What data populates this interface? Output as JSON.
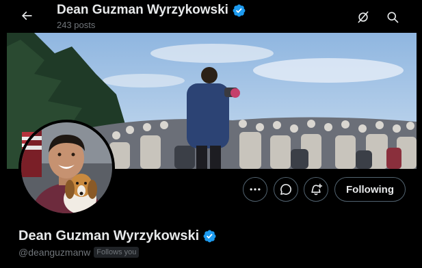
{
  "header": {
    "back_icon": "arrow-left-icon",
    "name": "Dean Guzman Wyrzykowski",
    "posts": "243 posts",
    "grok_icon": "grok-icon",
    "search_icon": "search-icon"
  },
  "profile": {
    "name": "Dean Guzman Wyrzykowski",
    "handle": "@deanguzmanw",
    "follows_you": "Follows you",
    "verified_icon": "verified-badge-icon"
  },
  "actions": {
    "more_icon": "more-horizontal-icon",
    "message_icon": "message-icon",
    "subscribe_icon": "bell-plus-icon",
    "follow_label": "Following"
  },
  "colors": {
    "background": "#000000",
    "text_primary": "#e7e9ea",
    "text_secondary": "#71767b",
    "border": "#536471",
    "verified": "#1d9bf0"
  }
}
